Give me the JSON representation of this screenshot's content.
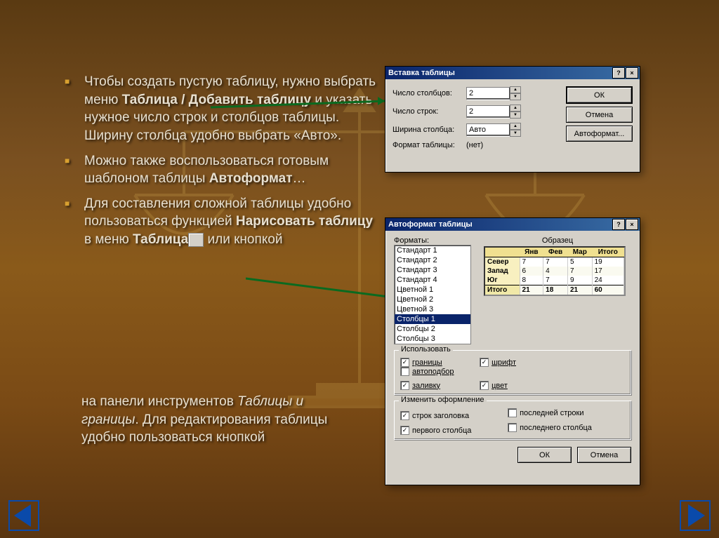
{
  "bullets": [
    {
      "pre": "Чтобы создать пустую таблицу,  нужно выбрать меню ",
      "b1": "Таблица / Добавить таблицу",
      "mid": " и указать  нужное число строк и столбцов таблицы. Ширину столбца удобно выбрать «Авто»."
    },
    {
      "pre": "Можно также воспользоваться готовым шаблоном таблицы ",
      "b1": "Автоформат",
      "mid": "…"
    },
    {
      "pre": "Для составления сложной таблицы удобно пользоваться функцией ",
      "b1": "Нарисовать таблицу",
      "mid": " в меню ",
      "b2": "Таблица",
      "mid2": " или кнопкой"
    }
  ],
  "trailing": {
    "pre": "  на панели инструментов ",
    "em": "Таблицы и границы",
    "post": ". Для редактирования таблицы удобно пользоваться кнопкой"
  },
  "dlg1": {
    "title": "Вставка таблицы",
    "lbl_cols": "Число столбцов:",
    "val_cols": "2",
    "lbl_rows": "Число строк:",
    "val_rows": "2",
    "lbl_width": "Ширина столбца:",
    "val_width": "Авто",
    "lbl_fmt": "Формат таблицы:",
    "val_fmt": "(нет)",
    "btn_ok": "ОК",
    "btn_cancel": "Отмена",
    "btn_auto": "Автоформат..."
  },
  "dlg2": {
    "title": "Автоформат таблицы",
    "lbl_formats": "Форматы:",
    "lbl_sample": "Образец",
    "formats": [
      "Стандарт 1",
      "Стандарт 2",
      "Стандарт 3",
      "Стандарт 4",
      "Цветной 1",
      "Цветной 2",
      "Цветной 3",
      "Столбцы 1",
      "Столбцы 2",
      "Столбцы 3"
    ],
    "selected": "Столбцы 1",
    "sample": {
      "cols": [
        "",
        "Янв",
        "Фев",
        "Мар",
        "Итого"
      ],
      "rows": [
        [
          "Север",
          "7",
          "7",
          "5",
          "19"
        ],
        [
          "Запад",
          "6",
          "4",
          "7",
          "17"
        ],
        [
          "Юг",
          "8",
          "7",
          "9",
          "24"
        ],
        [
          "Итого",
          "21",
          "18",
          "21",
          "60"
        ]
      ]
    },
    "grp_use": "Использовать",
    "chk_borders": "границы",
    "chk_font": "шрифт",
    "chk_autofit": "автоподбор",
    "chk_fill": "заливку",
    "chk_color": "цвет",
    "grp_apply": "Изменить оформление",
    "chk_headrow": "строк заголовка",
    "chk_lastrow": "последней строки",
    "chk_firstcol": "первого столбца",
    "chk_lastcol": "последнего столбца",
    "btn_ok": "ОК",
    "btn_cancel": "Отмена"
  }
}
